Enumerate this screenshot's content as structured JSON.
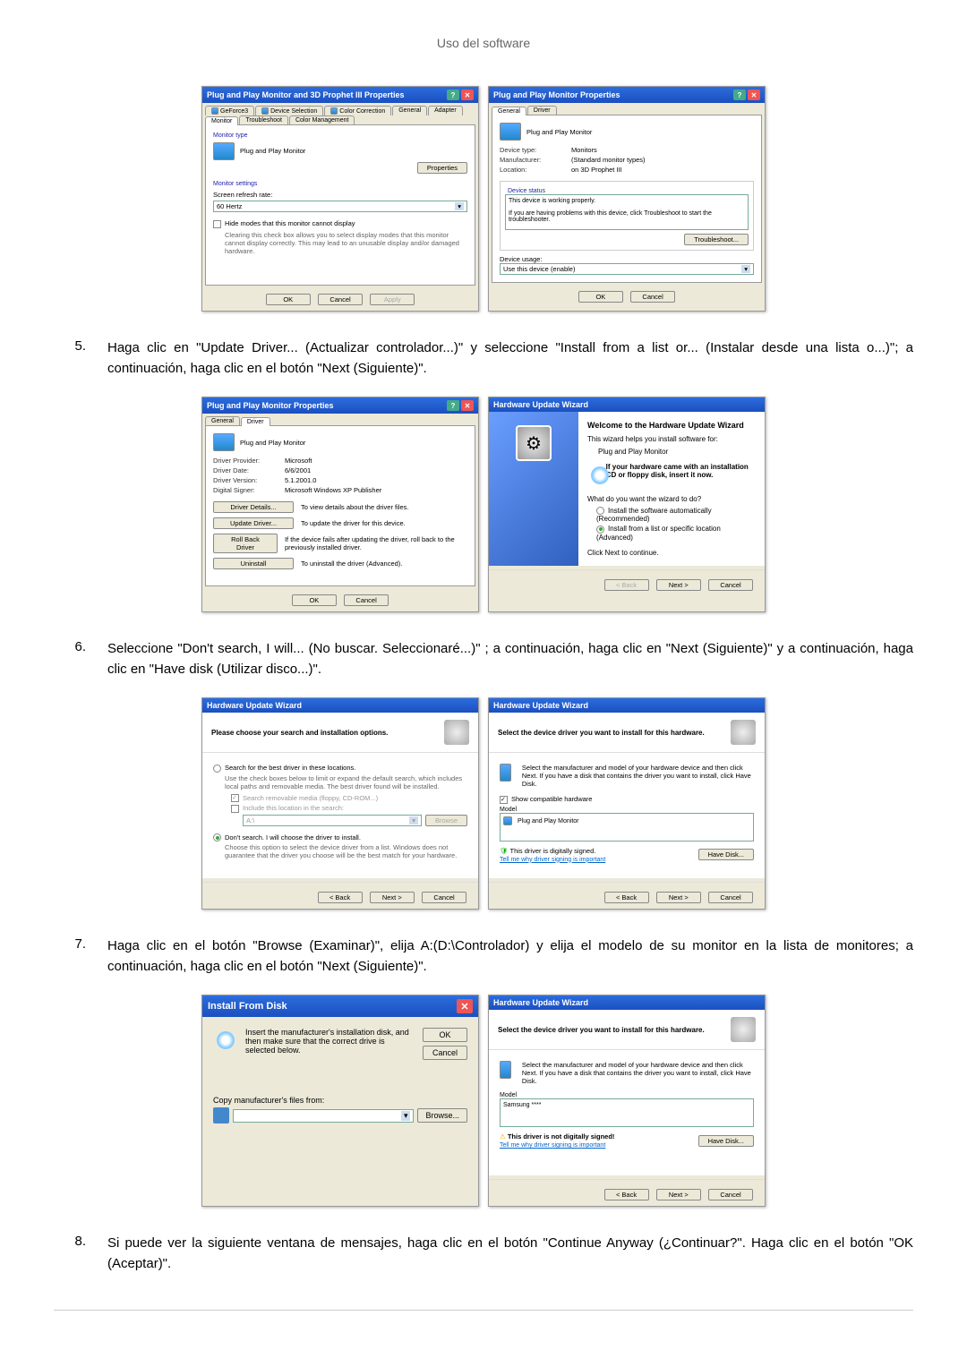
{
  "header": {
    "title": "Uso del software"
  },
  "steps": {
    "s5": {
      "num": "5.",
      "text": "Haga clic en \"Update Driver... (Actualizar controlador...)\" y seleccione \"Install from a list or... (Instalar desde una lista o...)\"; a continuación, haga clic en el botón \"Next (Siguiente)\"."
    },
    "s6": {
      "num": "6.",
      "text": "Seleccione \"Don't search, I will... (No buscar. Seleccionaré...)\" ; a continuación, haga clic en \"Next (Siguiente)\" y a continuación, haga clic en \"Have disk (Utilizar disco...)\"."
    },
    "s7": {
      "num": "7.",
      "text": "Haga clic en el botón \"Browse (Examinar)\", elija A:(D:\\Controlador) y elija el modelo de su monitor en la lista de monitores; a continuación, haga clic en el botón \"Next (Siguiente)\"."
    },
    "s8": {
      "num": "8.",
      "text": "Si puede ver la siguiente ventana de mensajes, haga clic en el botón \"Continue Anyway (¿Continuar?\". Haga clic en el botón \"OK (Aceptar)\"."
    }
  },
  "d1": {
    "title": "Plug and Play Monitor and 3D Prophet III Properties",
    "tabs": {
      "geforce": "GeForce3",
      "device": "Device Selection",
      "color": "Color Correction",
      "general": "General",
      "adapter": "Adapter",
      "monitor": "Monitor",
      "trouble": "Troubleshoot",
      "cmgmt": "Color Management"
    },
    "montype_label": "Monitor type",
    "montype": "Plug and Play Monitor",
    "properties_btn": "Properties",
    "monset_label": "Monitor settings",
    "refresh_label": "Screen refresh rate:",
    "refresh_val": "60 Hertz",
    "hide_check": "Hide modes that this monitor cannot display",
    "hide_desc": "Clearing this check box allows you to select display modes that this monitor cannot display correctly. This may lead to an unusable display and/or damaged hardware.",
    "ok": "OK",
    "cancel": "Cancel",
    "apply": "Apply"
  },
  "d2": {
    "title": "Plug and Play Monitor Properties",
    "tab_general": "General",
    "tab_driver": "Driver",
    "name": "Plug and Play Monitor",
    "devtype_l": "Device type:",
    "devtype_v": "Monitors",
    "manu_l": "Manufacturer:",
    "manu_v": "(Standard monitor types)",
    "loc_l": "Location:",
    "loc_v": "on 3D Prophet III",
    "status_label": "Device status",
    "status1": "This device is working properly.",
    "status2": "If you are having problems with this device, click Troubleshoot to start the troubleshooter.",
    "trouble_btn": "Troubleshoot...",
    "usage_l": "Device usage:",
    "usage_v": "Use this device (enable)",
    "ok": "OK",
    "cancel": "Cancel"
  },
  "d3": {
    "title": "Plug and Play Monitor Properties",
    "tab_general": "General",
    "tab_driver": "Driver",
    "name": "Plug and Play Monitor",
    "prov_l": "Driver Provider:",
    "prov_v": "Microsoft",
    "date_l": "Driver Date:",
    "date_v": "6/6/2001",
    "ver_l": "Driver Version:",
    "ver_v": "5.1.2001.0",
    "sig_l": "Digital Signer:",
    "sig_v": "Microsoft Windows XP Publisher",
    "details_btn": "Driver Details...",
    "details_desc": "To view details about the driver files.",
    "update_btn": "Update Driver...",
    "update_desc": "To update the driver for this device.",
    "rollback_btn": "Roll Back Driver",
    "rollback_desc": "If the device fails after updating the driver, roll back to the previously installed driver.",
    "uninstall_btn": "Uninstall",
    "uninstall_desc": "To uninstall the driver (Advanced).",
    "ok": "OK",
    "cancel": "Cancel"
  },
  "d4": {
    "title": "Hardware Update Wizard",
    "heading": "Welcome to the Hardware Update Wizard",
    "l1": "This wizard helps you install software for:",
    "l2": "Plug and Play Monitor",
    "l3": "If your hardware came with an installation CD or floppy disk, insert it now.",
    "l4": "What do you want the wizard to do?",
    "opt1": "Install the software automatically (Recommended)",
    "opt2": "Install from a list or specific location (Advanced)",
    "l5": "Click Next to continue.",
    "back": "< Back",
    "next": "Next >",
    "cancel": "Cancel"
  },
  "d5": {
    "title": "Hardware Update Wizard",
    "heading": "Please choose your search and installation options.",
    "opt1": "Search for the best driver in these locations.",
    "opt1_desc": "Use the check boxes below to limit or expand the default search, which includes local paths and removable media. The best driver found will be installed.",
    "chk1": "Search removable media (floppy, CD-ROM...)",
    "chk2": "Include this location in the search:",
    "path": "A:\\",
    "browse_btn": "Browse",
    "opt2": "Don't search. I will choose the driver to install.",
    "opt2_desc": "Choose this option to select the device driver from a list. Windows does not guarantee that the driver you choose will be the best match for your hardware.",
    "back": "< Back",
    "next": "Next >",
    "cancel": "Cancel"
  },
  "d6": {
    "title": "Hardware Update Wizard",
    "heading": "Select the device driver you want to install for this hardware.",
    "desc": "Select the manufacturer and model of your hardware device and then click Next. If you have a disk that contains the driver you want to install, click Have Disk.",
    "compat": "Show compatible hardware",
    "model_l": "Model",
    "model_v": "Plug and Play Monitor",
    "signed": "This driver is digitally signed.",
    "link": "Tell me why driver signing is important",
    "havedisk_btn": "Have Disk...",
    "back": "< Back",
    "next": "Next >",
    "cancel": "Cancel"
  },
  "d7": {
    "title": "Install From Disk",
    "desc": "Insert the manufacturer's installation disk, and then make sure that the correct drive is selected below.",
    "ok": "OK",
    "cancel": "Cancel",
    "copy_l": "Copy manufacturer's files from:",
    "path": "",
    "browse_btn": "Browse..."
  },
  "d8": {
    "title": "Hardware Update Wizard",
    "heading": "Select the device driver you want to install for this hardware.",
    "desc": "Select the manufacturer and model of your hardware device and then click Next. If you have a disk that contains the driver you want to install, click Have Disk.",
    "model_l": "Model",
    "model_v": "Samsung ****",
    "unsigned": "This driver is not digitally signed!",
    "link": "Tell me why driver signing is important",
    "havedisk_btn": "Have Disk...",
    "back": "< Back",
    "next": "Next >",
    "cancel": "Cancel"
  }
}
